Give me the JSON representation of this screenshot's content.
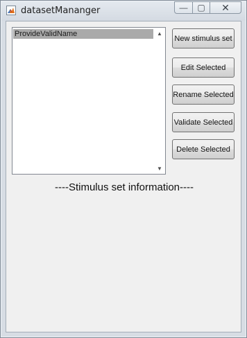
{
  "window": {
    "title": "datasetMananger",
    "controls": {
      "minimize": "—",
      "maximize": "▢",
      "close": "✕"
    }
  },
  "listbox": {
    "items": [
      "ProvideValidName"
    ],
    "selected_index": 0
  },
  "buttons": {
    "new": "New stimulus set",
    "edit": "Edit Selected",
    "rename": "Rename Selected",
    "validate": "Validate Selected",
    "delete": "Delete Selected"
  },
  "info": {
    "label": "----Stimulus set information----"
  },
  "colors": {
    "selection": "#aaaaaa",
    "panel": "#f0f0f0",
    "titlebar": "#d7dde4"
  }
}
